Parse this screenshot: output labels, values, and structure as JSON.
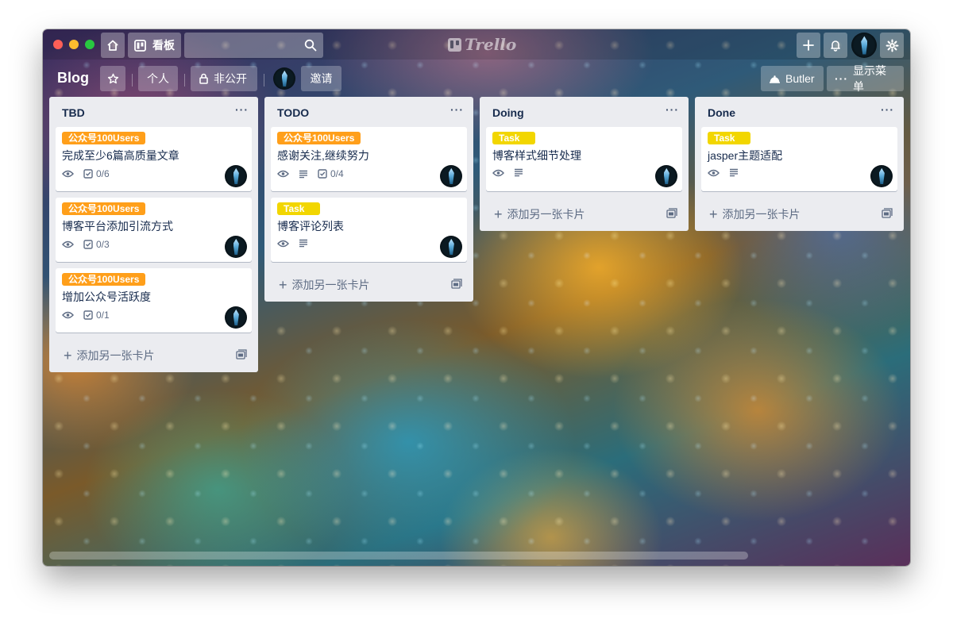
{
  "header": {
    "boards_label": "看板",
    "search_placeholder": "",
    "logo_text": "Trello"
  },
  "board": {
    "title": "Blog",
    "team_label": "个人",
    "visibility_label": "非公开",
    "invite_label": "邀请",
    "butler_label": "Butler",
    "menu_label": "显示菜单"
  },
  "lists": [
    {
      "title": "TBD",
      "cards": [
        {
          "label": "公众号100Users",
          "title": "完成至少6篇高质量文章",
          "checklist": "0/6"
        },
        {
          "label": "公众号100Users",
          "title": "博客平台添加引流方式",
          "checklist": "0/3"
        },
        {
          "label": "公众号100Users",
          "title": "增加公众号活跃度",
          "checklist": "0/1"
        }
      ],
      "add_card": "添加另一张卡片"
    },
    {
      "title": "TODO",
      "cards": [
        {
          "label": "公众号100Users",
          "title": "感谢关注,继续努力",
          "checklist": "0/4"
        },
        {
          "label": "Task",
          "title": "博客评论列表"
        }
      ],
      "add_card": "添加另一张卡片"
    },
    {
      "title": "Doing",
      "cards": [
        {
          "label": "Task",
          "title": "博客样式细节处理"
        }
      ],
      "add_card": "添加另一张卡片"
    },
    {
      "title": "Done",
      "cards": [
        {
          "label": "Task",
          "title": "jasper主题适配"
        }
      ],
      "add_card": "添加另一张卡片"
    }
  ],
  "colors": {
    "label_orange": "#ff9f1a",
    "label_yellow": "#f2d600",
    "list_bg": "#ebecf0"
  }
}
